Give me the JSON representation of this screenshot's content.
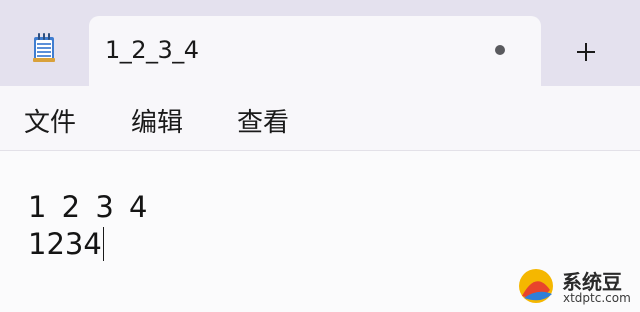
{
  "tab": {
    "title": "1_2_3_4",
    "unsaved": true,
    "new_tab_icon": "plus-icon"
  },
  "app_icon": "notepad-icon",
  "menu": {
    "file": "文件",
    "edit": "编辑",
    "view": "查看"
  },
  "editor": {
    "lines": [
      "1 2 3 4",
      "1234"
    ]
  },
  "watermark": {
    "name": "系统豆",
    "url": "xtdptc.com"
  },
  "colors": {
    "titlebar": "#e4e1ee",
    "tab_background": "#f8f7fa",
    "editor_background": "#fbfbfc",
    "text": "#1a1a1a"
  }
}
